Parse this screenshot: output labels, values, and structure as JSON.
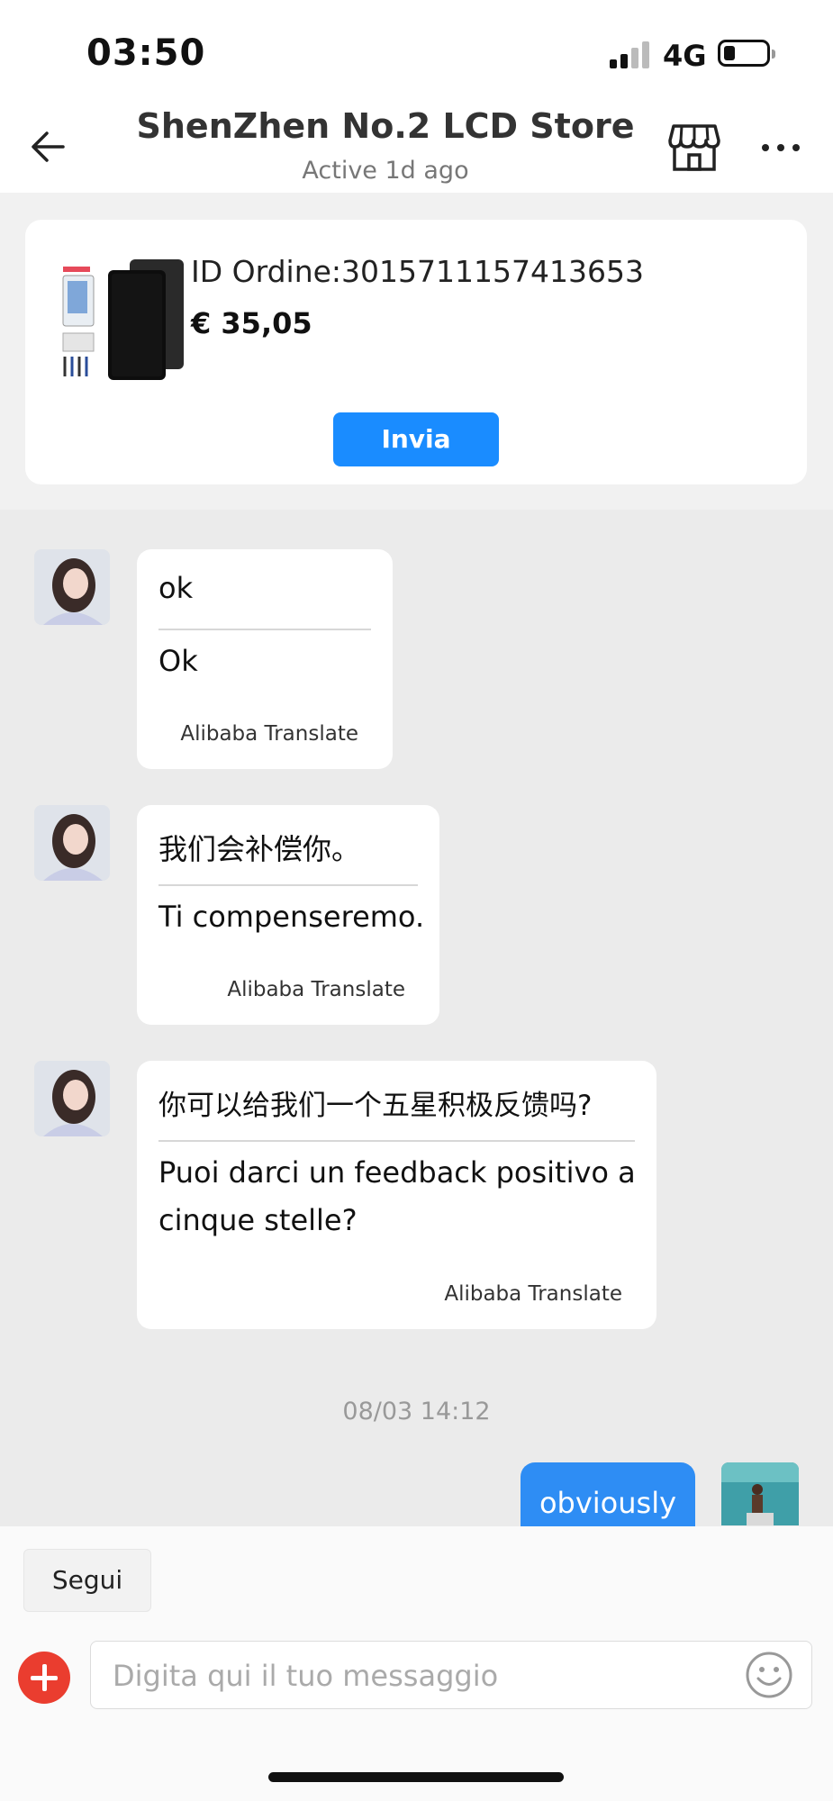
{
  "status_bar": {
    "time": "03:50",
    "network": "4G"
  },
  "header": {
    "title": "ShenZhen No.2 LCD Store",
    "subtitle": "Active 1d ago"
  },
  "order": {
    "id_text": "ID Ordine:3015711157413653",
    "price": "€ 35,05",
    "send_label": "Invia"
  },
  "messages": [
    {
      "original": "ok",
      "translation": "Ok",
      "credit": "Alibaba Translate"
    },
    {
      "original": "我们会补偿你。",
      "translation": "Ti compenseremo.",
      "credit": "Alibaba Translate"
    },
    {
      "original": "你可以给我们一个五星积极反馈吗?",
      "translation_line1": "Puoi darci un feedback positivo a",
      "translation_line2": "cinque stelle?",
      "credit": "Alibaba Translate"
    }
  ],
  "timestamp": "08/03 14:12",
  "my_message": {
    "text": "obviously"
  },
  "bottom": {
    "follow_label": "Segui",
    "input_placeholder": "Digita qui il tuo messaggio"
  },
  "colors": {
    "accent_blue": "#1a8cff",
    "my_bubble": "#2e8df4",
    "plus_red": "#ea3d2f",
    "background": "#ebebeb"
  },
  "icons": [
    "back-arrow-icon",
    "store-icon",
    "more-icon",
    "plus-icon",
    "emoji-icon"
  ]
}
